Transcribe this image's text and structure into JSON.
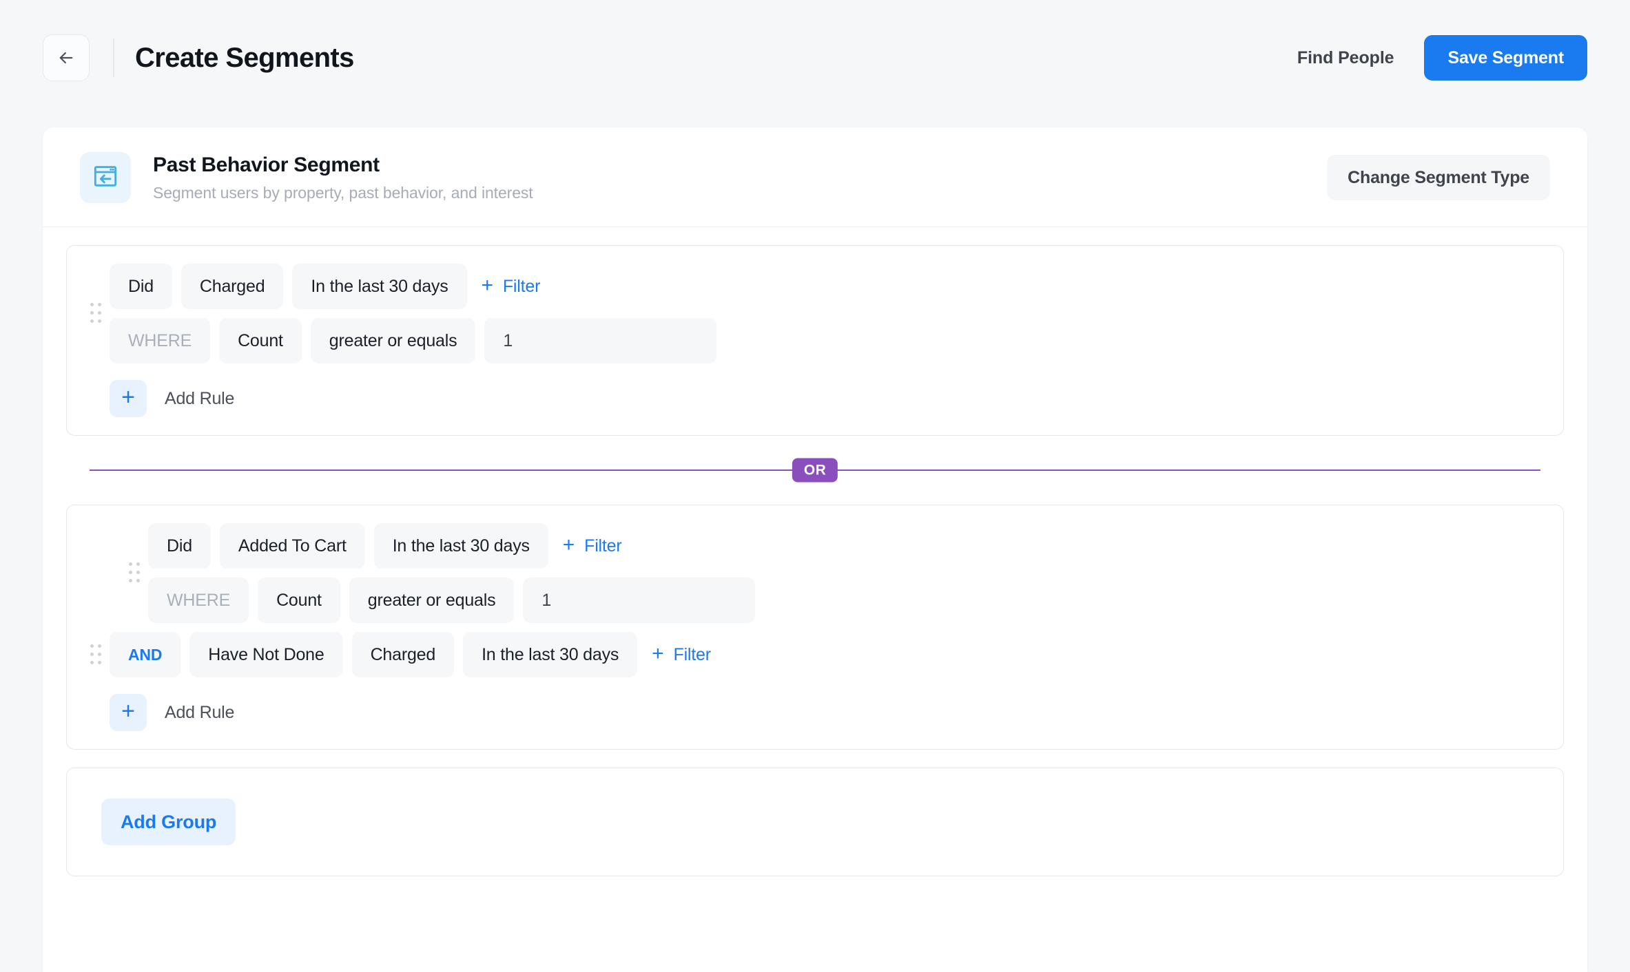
{
  "header": {
    "back_icon": "arrow-left-icon",
    "title": "Create Segments",
    "find_people_label": "Find People",
    "save_label": "Save Segment",
    "accent_color": "#1a7aef"
  },
  "segment_card": {
    "icon": "window-back-arrow-icon",
    "title": "Past Behavior Segment",
    "subtitle": "Segment users by property, past behavior, and interest",
    "change_type_label": "Change Segment Type"
  },
  "builder": {
    "filter_label": "Filter",
    "filter_plus": "+",
    "add_rule_label": "Add Rule",
    "add_rule_plus": "+",
    "add_group_label": "Add Group",
    "divider_label": "OR",
    "divider_color": "#8b4fbd",
    "groups": [
      {
        "rules": [
          {
            "connector": null,
            "action": "Did",
            "event": "Charged",
            "timeframe": "In the last 30 days",
            "where_label": "WHERE",
            "property": "Count",
            "operator": "greater or equals",
            "value": "1"
          }
        ]
      },
      {
        "rules": [
          {
            "connector": null,
            "action": "Did",
            "event": "Added To Cart",
            "timeframe": "In the last 30 days",
            "where_label": "WHERE",
            "property": "Count",
            "operator": "greater or equals",
            "value": "1"
          },
          {
            "connector": "AND",
            "action": "Have Not Done",
            "event": "Charged",
            "timeframe": "In the last 30 days"
          }
        ]
      }
    ]
  }
}
